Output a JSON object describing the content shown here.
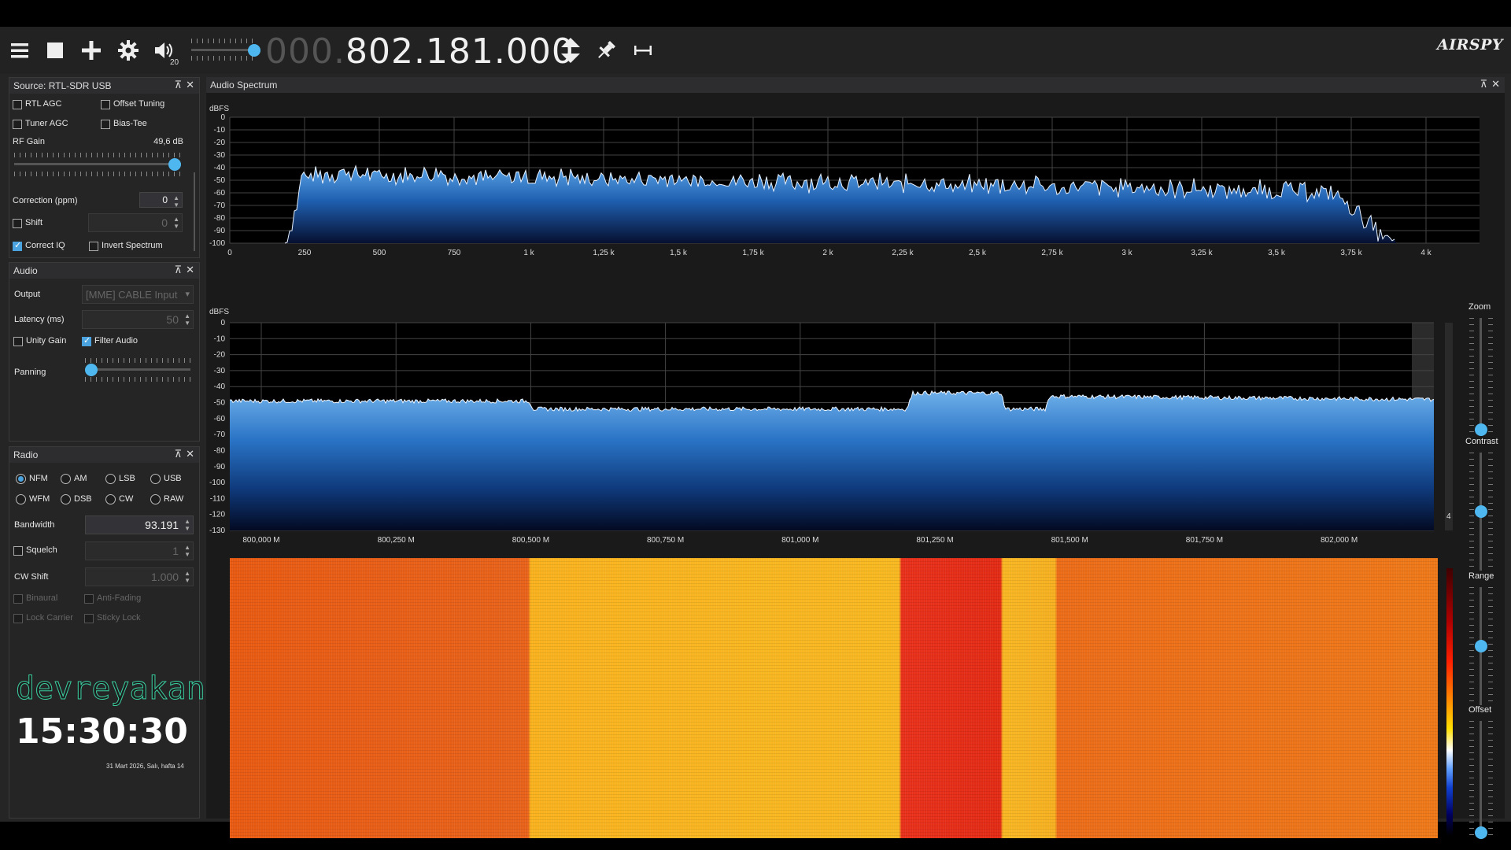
{
  "toolbar": {
    "volume_level_label": "20",
    "frequency_dim": "000.",
    "frequency_lit": "802.181.000",
    "logo": "AIRSPY"
  },
  "source_panel": {
    "title": "Source: RTL-SDR USB",
    "rtl_agc": "RTL AGC",
    "offset_tuning": "Offset Tuning",
    "tuner_agc": "Tuner AGC",
    "bias_tee": "Bias-Tee",
    "rf_gain_label": "RF Gain",
    "rf_gain_value": "49,6 dB",
    "rf_gain_level": 1.0,
    "correction_label": "Correction (ppm)",
    "correction_value": "0",
    "shift_label": "Shift",
    "shift_value": "0",
    "correct_iq": "Correct IQ",
    "invert_spectrum": "Invert Spectrum"
  },
  "audio_panel": {
    "title": "Audio",
    "output_label": "Output",
    "output_value": "[MME] CABLE Input",
    "latency_label": "Latency (ms)",
    "latency_value": "50",
    "unity_gain": "Unity Gain",
    "filter_audio": "Filter Audio",
    "panning_label": "Panning",
    "panning_level": 0.0
  },
  "radio_panel": {
    "title": "Radio",
    "modes": [
      "NFM",
      "AM",
      "LSB",
      "USB",
      "WFM",
      "DSB",
      "CW",
      "RAW"
    ],
    "selected_mode": "NFM",
    "bandwidth_label": "Bandwidth",
    "bandwidth_value": "93.191",
    "squelch_label": "Squelch",
    "squelch_value": "1",
    "cw_shift_label": "CW Shift",
    "cw_shift_value": "1.000",
    "binaural": "Binaural",
    "anti_fading": "Anti-Fading",
    "lock_carrier": "Lock Carrier",
    "sticky_lock": "Sticky Lock"
  },
  "overlay": {
    "brand": "devreyakan",
    "clock": "15:30:30",
    "date": "31 Mart 2026, Salı, hafta 14"
  },
  "audio_spectrum": {
    "title": "Audio Spectrum",
    "ylabel": "dBFS",
    "yticks": [
      "0",
      "-10",
      "-20",
      "-30",
      "-40",
      "-50",
      "-60",
      "-70",
      "-80",
      "-90",
      "-100"
    ],
    "xticks": [
      "0",
      "250",
      "500",
      "750",
      "1 k",
      "1,25 k",
      "1,5 k",
      "1,75 k",
      "2 k",
      "2,25 k",
      "2,5 k",
      "2,75 k",
      "3 k",
      "3,25 k",
      "3,5 k",
      "3,75 k",
      "4 k"
    ]
  },
  "rf_spectrum": {
    "ylabel": "dBFS",
    "yticks": [
      "0",
      "-10",
      "-20",
      "-30",
      "-40",
      "-50",
      "-60",
      "-70",
      "-80",
      "-90",
      "-100",
      "-110",
      "-120",
      "-130"
    ],
    "xticks": [
      "800,000 M",
      "800,250 M",
      "800,500 M",
      "800,750 M",
      "801,000 M",
      "801,250 M",
      "801,500 M",
      "801,750 M",
      "802,000 M"
    ],
    "fft_scale_label": "4"
  },
  "right_controls": {
    "zoom": "Zoom",
    "contrast": "Contrast",
    "range": "Range",
    "offset": "Offset",
    "zoom_level": 0.0,
    "contrast_level": 0.5,
    "range_level": 0.5,
    "offset_level": 0.0
  },
  "colors": {
    "accent": "#4fb7ef",
    "spectrum_fill_top": "#4a90d9",
    "spectrum_fill_bottom": "#0a1633",
    "waterfall_hot": "#e02010",
    "waterfall_mid": "#f07a10",
    "waterfall_warm": "#f8b820"
  }
}
